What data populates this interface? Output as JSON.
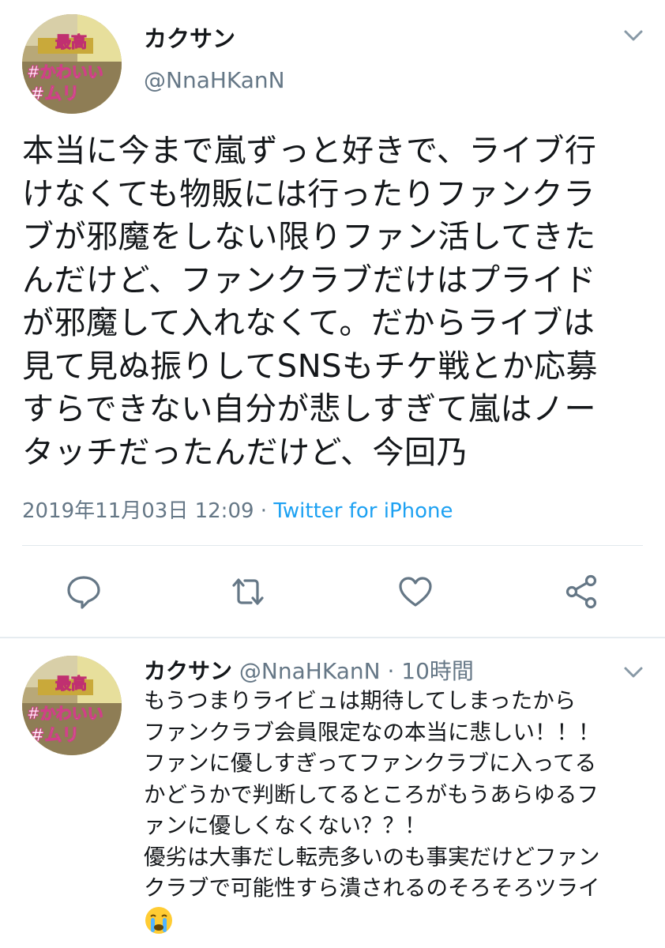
{
  "tweet": {
    "display_name": "カクサン",
    "handle": "@NnaHKanN",
    "text_lines": [
      "本当に今まで嵐ずっと好きで、ライブ行",
      "けなくても物販には行ったりファンクラ",
      "ブが邪魔をしない限りファン活してきた",
      "んだけど、ファンクラブだけはプライド",
      "が邪魔して入れなくて。だからライブは",
      "見て見ぬ振りしてSNSもチケ戦とか応募",
      "すらできない自分が悲しすぎて嵐はノー",
      "タッチだったんだけど、今回乃"
    ],
    "timestamp": "2019年11月03日 12:09",
    "separator": " · ",
    "source": "Twitter for iPhone",
    "avatar_text": [
      "最高",
      "#かわいい",
      "#ムリ"
    ]
  },
  "actions": {
    "reply_icon": "comment-icon",
    "retweet_icon": "retweet-icon",
    "like_icon": "heart-icon",
    "share_icon": "share-icon"
  },
  "reply": {
    "display_name": "カクサン",
    "handle": "@NnaHKanN",
    "time": "10時間",
    "separator": " · ",
    "text_lines": [
      "もうつまりライビュは期待してしまったから",
      "ファンクラブ会員限定なの本当に悲しい！！！",
      "ファンに優しすぎってファンクラブに入ってる",
      "かどうかで判断してるところがもうあらゆるフ",
      "ァンに優しくなくない？？！",
      "優劣は大事だし転売多いのも事実だけどファン",
      "クラブで可能性すら潰されるのそろそろツライ"
    ],
    "emoji": "crying-face-emoji"
  },
  "colors": {
    "text": "#14171a",
    "secondary": "#657786",
    "link": "#1da1f2",
    "divider": "#e1e8ed"
  }
}
